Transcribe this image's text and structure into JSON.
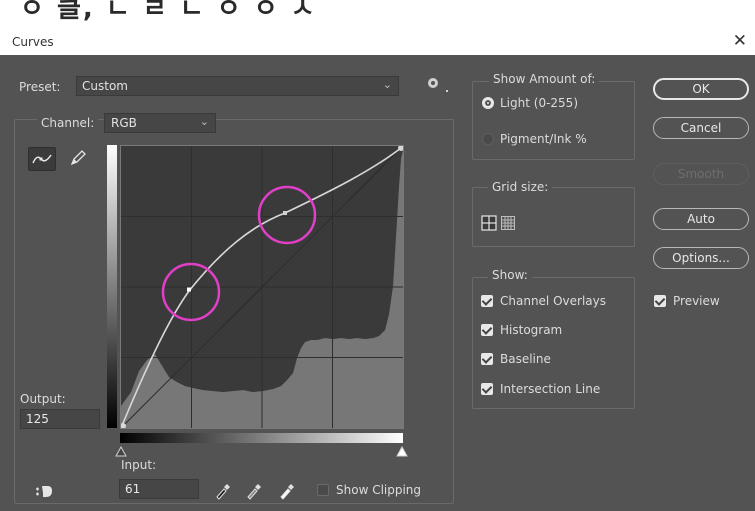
{
  "header_strip": {
    "text": "ㅇ 클, ㄴ ㄹ ㄴ ㅇ ㅇ ㅅ"
  },
  "window": {
    "title": "Curves",
    "close_glyph": "✕"
  },
  "preset": {
    "label": "Preset:",
    "value": "Custom",
    "icon": "gear-icon"
  },
  "channel": {
    "label": "Channel:",
    "value": "RGB"
  },
  "tools": [
    {
      "icon": "curve-point-tool-icon",
      "active": true
    },
    {
      "icon": "pencil-icon",
      "active": false
    }
  ],
  "output": {
    "label": "Output:",
    "value": "125"
  },
  "input": {
    "label": "Input:",
    "value": "61"
  },
  "show_clipping": {
    "label": "Show Clipping",
    "checked": false
  },
  "eyedroppers": [
    "black-point-eyedropper-icon",
    "gray-point-eyedropper-icon",
    "white-point-eyedropper-icon"
  ],
  "on_image_tool": {
    "icon": "on-image-adjustment-icon"
  },
  "show_amount": {
    "title": "Show Amount of:",
    "options": [
      {
        "label": "Light  (0-255)",
        "selected": true
      },
      {
        "label": "Pigment/Ink %",
        "selected": false
      }
    ]
  },
  "grid_size": {
    "title": "Grid size:",
    "icons": [
      "simple-grid-icon",
      "detailed-grid-icon"
    ]
  },
  "show": {
    "title": "Show:",
    "items": [
      {
        "label": "Channel Overlays",
        "checked": true
      },
      {
        "label": "Histogram",
        "checked": true
      },
      {
        "label": "Baseline",
        "checked": true
      },
      {
        "label": "Intersection Line",
        "checked": true
      }
    ]
  },
  "buttons": {
    "ok": "OK",
    "cancel": "Cancel",
    "smooth": "Smooth",
    "auto": "Auto",
    "options": "Options..."
  },
  "preview": {
    "label": "Preview",
    "checked": true
  },
  "colors": {
    "dialog_bg": "#535353",
    "field_bg": "#464646",
    "highlight_circle": "#e040c8"
  }
}
